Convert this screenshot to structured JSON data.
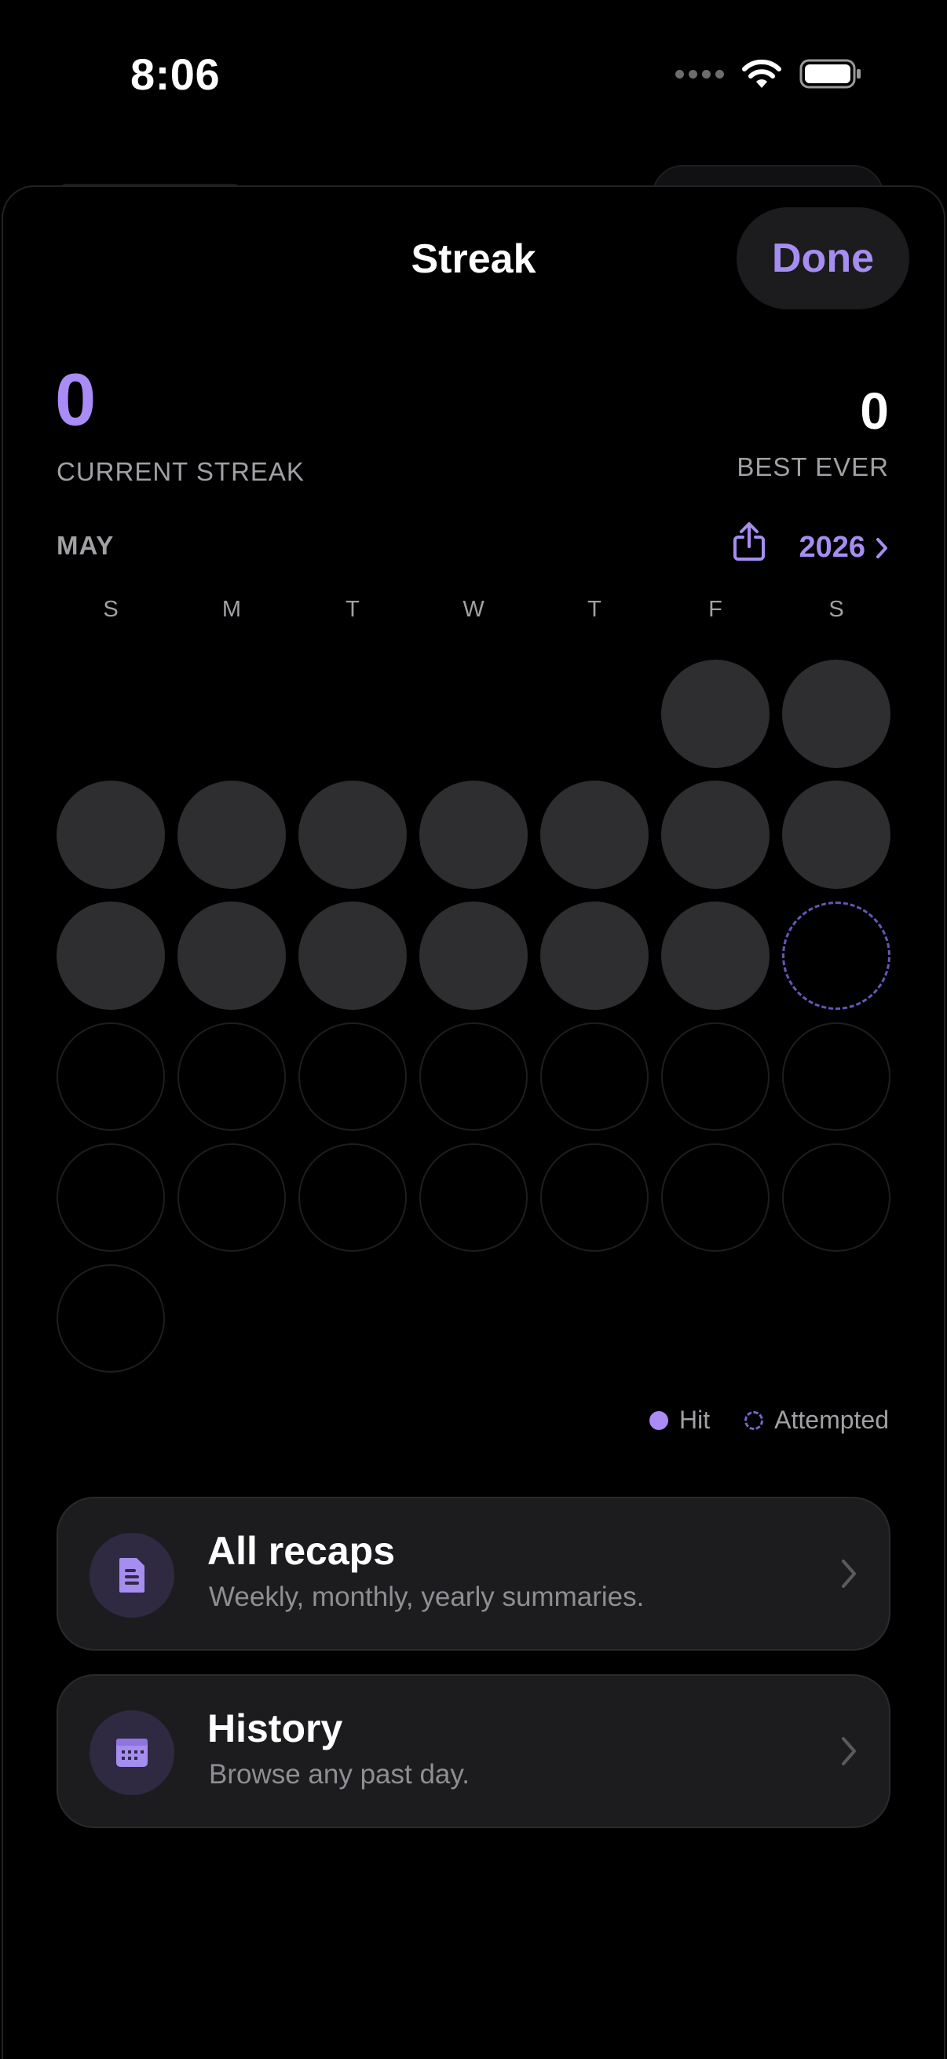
{
  "status": {
    "time": "8:06"
  },
  "sheet": {
    "title": "Streak",
    "done_label": "Done"
  },
  "streak": {
    "current_value": "0",
    "current_label": "CURRENT STREAK",
    "best_value": "0",
    "best_label": "BEST EVER"
  },
  "calendar": {
    "month": "MAY",
    "year": "2026",
    "weekdays": [
      "S",
      "M",
      "T",
      "W",
      "T",
      "F",
      "S"
    ],
    "first_weekday_index": 5,
    "days_in_month": 31,
    "today": 16,
    "attempted_days": [
      16
    ],
    "hit_days": []
  },
  "legend": {
    "hit_label": "Hit",
    "attempted_label": "Attempted"
  },
  "cards": [
    {
      "title": "All recaps",
      "subtitle": "Weekly, monthly, yearly summaries.",
      "icon": "document-icon"
    },
    {
      "title": "History",
      "subtitle": "Browse any past day.",
      "icon": "calendar-icon"
    }
  ],
  "colors": {
    "accent": "#a68df0",
    "background": "#000000",
    "card": "#1c1c1e",
    "past_day": "#2e2e30"
  }
}
